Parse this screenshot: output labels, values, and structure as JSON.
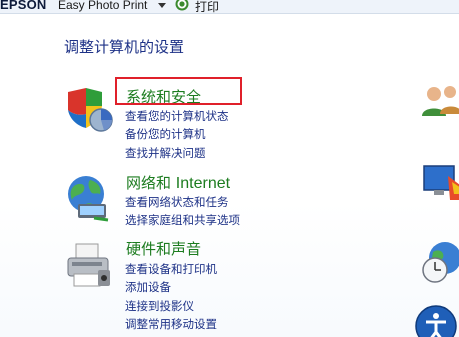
{
  "toolbar": {
    "brand": "EPSON",
    "app_name": "Easy Photo Print",
    "print_label": "打印"
  },
  "page_title": "调整计算机的设置",
  "categories": [
    {
      "title": "系统和安全",
      "icon": "shield-icon",
      "links": [
        "查看您的计算机状态",
        "备份您的计算机",
        "查找并解决问题"
      ]
    },
    {
      "title_cn": "网络和",
      "title_en": "Internet",
      "icon": "network-globe-icon",
      "links": [
        "查看网络状态和任务",
        "选择家庭组和共享选项"
      ]
    },
    {
      "title": "硬件和声音",
      "icon": "printer-icon",
      "links": [
        "查看设备和打印机",
        "添加设备",
        "连接到投影仪",
        "调整常用移动设置"
      ]
    }
  ],
  "right_column_icons": [
    "user-accounts-icon",
    "appearance-icon",
    "clock-globe-icon",
    "ease-of-access-icon"
  ],
  "colors": {
    "title": "#1e3287",
    "category": "#1c7c1f",
    "link": "#1e3287",
    "highlight": "#e0202a"
  }
}
